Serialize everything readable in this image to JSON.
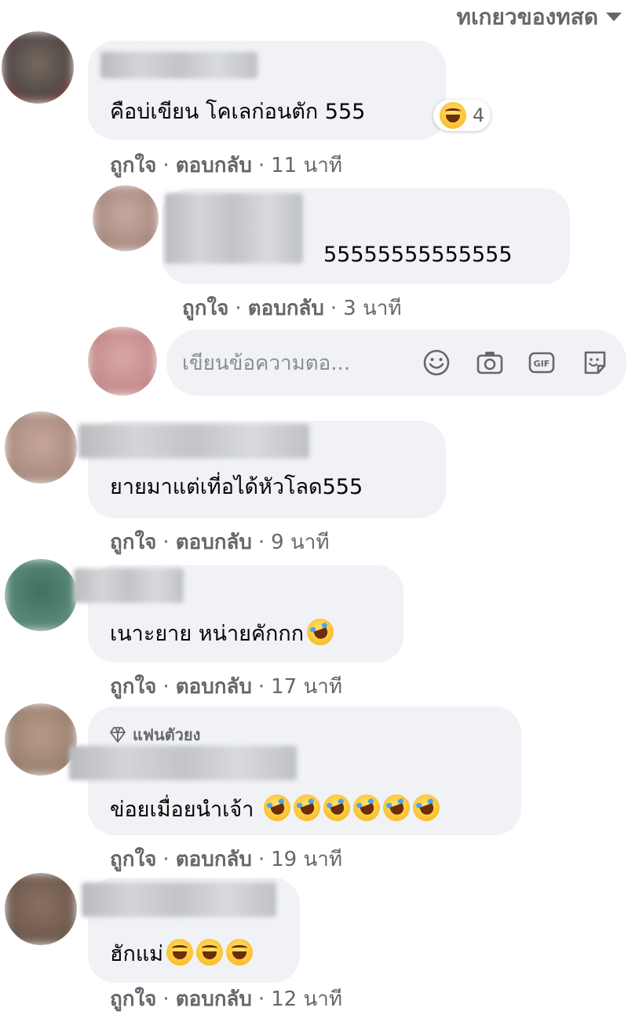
{
  "sort_label": "ทเกยวของทสด",
  "colors": {
    "bubble": "#f0f2f5",
    "meta": "#65676b",
    "text": "#050505"
  },
  "composer": {
    "placeholder": "เขียนข้อความตอ..."
  },
  "icons": [
    "smiley-icon",
    "camera-icon",
    "gif-icon",
    "sticker-icon"
  ],
  "comments": [
    {
      "text": "คือบ่เขียน โคเลก่อนตัก 555",
      "like": "ถูกใจ",
      "reply": "ตอบกลับ",
      "time": "11 นาที",
      "reaction_count": "4"
    },
    {
      "text": "55555555555555",
      "like": "ถูกใจ",
      "reply": "ตอบกลับ",
      "time": "3 นาที"
    },
    {
      "text": "ยายมาแต่เที่อได้หัวโลด555",
      "like": "ถูกใจ",
      "reply": "ตอบกลับ",
      "time": "9 นาที"
    },
    {
      "text": "เนาะยาย หน่ายคักกก",
      "like": "ถูกใจ",
      "reply": "ตอบกลับ",
      "time": "17 นาที"
    },
    {
      "badge": "แฟนตัวยง",
      "text": "ข่อยเมื่อยนำเจ้า",
      "like": "ถูกใจ",
      "reply": "ตอบกลับ",
      "time": "19 นาที"
    },
    {
      "text": "ฮักแม่",
      "like": "ถูกใจ",
      "reply": "ตอบกลับ",
      "time": "12 นาที"
    }
  ]
}
